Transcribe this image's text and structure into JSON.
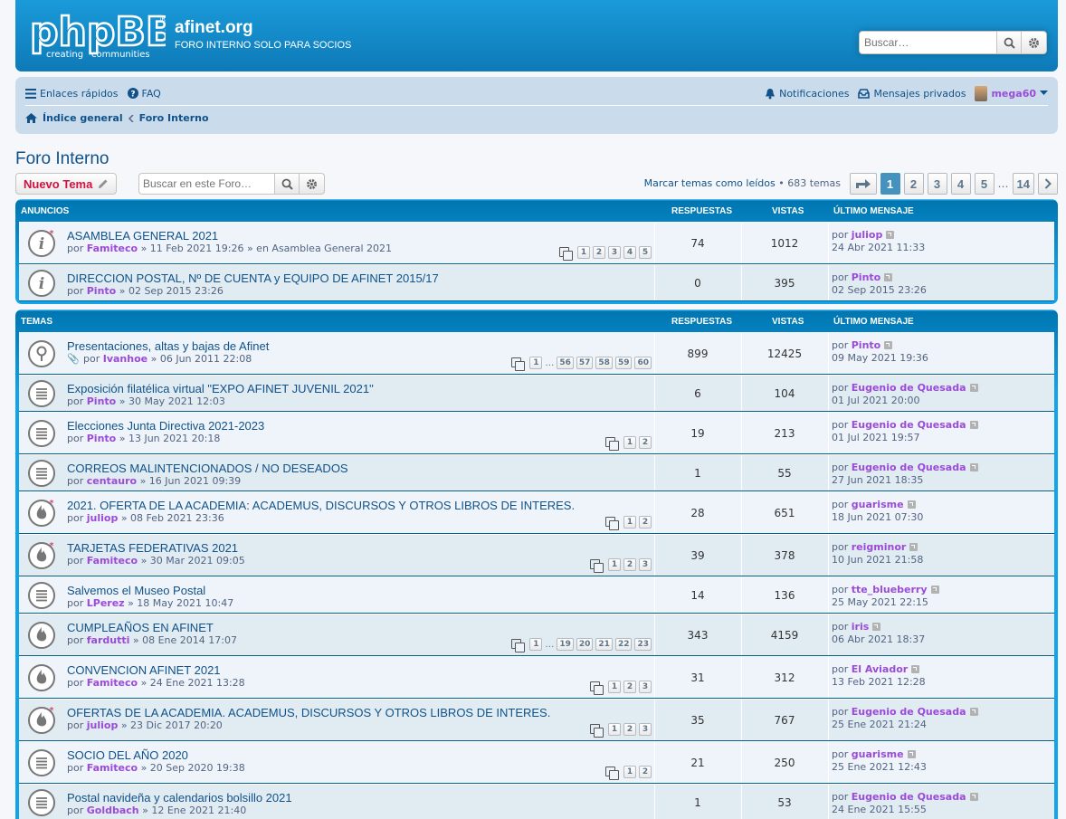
{
  "header": {
    "site_title": "afinet.org",
    "site_desc": "FORO INTERNO SOLO PARA SOCIOS",
    "logo_main": "phpBB",
    "logo_sub1": "creating",
    "logo_sub2": "communities",
    "search_placeholder": "Buscar…"
  },
  "navbar": {
    "quick_links": "Enlaces rápidos",
    "faq": "FAQ",
    "notifications": "Notificaciones",
    "pm": "Mensajes privados",
    "username": "mega60",
    "crumb_home": "Índice general",
    "crumb_forum": "Foro Interno"
  },
  "forum": {
    "title": "Foro Interno",
    "new_topic": "Nuevo Tema",
    "search_placeholder": "Buscar en este Foro…",
    "mark_read": "Marcar temas como leídos",
    "topic_count": "683 temas",
    "pages": [
      "1",
      "2",
      "3",
      "4",
      "5",
      "14"
    ],
    "bullet": "•",
    "dots": "…"
  },
  "columns": {
    "respuestas": "RESPUESTAS",
    "vistas": "VISTAS",
    "ultimo": "ÚLTIMO MENSAJE"
  },
  "announcements": {
    "header": "ANUNCIOS",
    "rows": [
      {
        "title": "ASAMBLEA GENERAL 2021",
        "por": "por",
        "author": "Famiteco",
        "date": "» 11 Feb 2021 19:26 » en Asamblea General 2021",
        "replies": "74",
        "views": "1012",
        "last_user": "juliop",
        "last_date": "24 Abr 2021 11:33",
        "pages": [
          "1",
          "2",
          "3",
          "4",
          "5"
        ]
      },
      {
        "title": "DIRECCION POSTAL, Nº DE CUENTA y EQUIPO DE AFINET 2015/17",
        "por": "por",
        "author": "Pinto",
        "date": "» 02 Sep 2015 23:26",
        "replies": "0",
        "views": "395",
        "last_user": "Pinto",
        "last_date": "02 Sep 2015 23:26",
        "pages": []
      }
    ]
  },
  "topics": {
    "header": "TEMAS",
    "rows": [
      {
        "title": "Presentaciones, altas y bajas de Afinet",
        "por": "por",
        "author": "Ivanhoe",
        "date": "» 06 Jun 2011 22:08",
        "replies": "899",
        "views": "12425",
        "last_user": "Pinto",
        "last_date": "09 May 2021 19:36",
        "pages": [
          "1",
          "…",
          "56",
          "57",
          "58",
          "59",
          "60"
        ]
      },
      {
        "title": "Exposición filatélica virtual \"EXPO AFINET JUVENIL 2021\"",
        "por": "por",
        "author": "Pinto",
        "date": "» 30 May 2021 12:03",
        "replies": "6",
        "views": "104",
        "last_user": "Eugenio de Quesada",
        "last_date": "01 Jul 2021 20:00",
        "pages": []
      },
      {
        "title": "Elecciones Junta Directiva 2021-2023",
        "por": "por",
        "author": "Pinto",
        "date": "» 13 Jun 2021 20:18",
        "replies": "19",
        "views": "213",
        "last_user": "Eugenio de Quesada",
        "last_date": "01 Jul 2021 19:57",
        "pages": [
          "1",
          "2"
        ]
      },
      {
        "title": "CORREOS MALINTENCIONADOS / NO DESEADOS",
        "por": "por",
        "author": "centauro",
        "date": "» 16 Jun 2021 09:39",
        "replies": "1",
        "views": "55",
        "last_user": "Eugenio de Quesada",
        "last_date": "27 Jun 2021 18:35",
        "pages": []
      },
      {
        "title": "2021. OFERTA DE LA ACADEMIA: ACADEMUS, DISCURSOS Y OTROS LIBROS DE INTERES.",
        "por": "por",
        "author": "juliop",
        "date": "» 08 Feb 2021 23:36",
        "replies": "28",
        "views": "651",
        "last_user": "guarisme",
        "last_date": "18 Jun 2021 07:30",
        "pages": [
          "1",
          "2"
        ]
      },
      {
        "title": "TARJETAS FEDERATIVAS 2021",
        "por": "por",
        "author": "Famiteco",
        "date": "» 30 Mar 2021 09:05",
        "replies": "39",
        "views": "378",
        "last_user": "reigminor",
        "last_date": "10 Jun 2021 21:58",
        "pages": [
          "1",
          "2",
          "3"
        ]
      },
      {
        "title": "Salvemos el Museo Postal",
        "por": "por",
        "author": "LPerez",
        "date": "» 18 May 2021 10:47",
        "replies": "14",
        "views": "136",
        "last_user": "tte_blueberry",
        "last_date": "25 May 2021 22:15",
        "pages": []
      },
      {
        "title": "CUMPLEAÑOS EN AFINET",
        "por": "por",
        "author": "fardutti",
        "date": "» 08 Ene 2014 17:07",
        "replies": "343",
        "views": "4159",
        "last_user": "iris",
        "last_date": "06 Abr 2021 18:37",
        "pages": [
          "1",
          "…",
          "19",
          "20",
          "21",
          "22",
          "23"
        ]
      },
      {
        "title": "CONVENCION AFINET 2021",
        "por": "por",
        "author": "Famiteco",
        "date": "» 24 Ene 2021 13:28",
        "replies": "31",
        "views": "312",
        "last_user": "El Aviador",
        "last_date": "13 Feb 2021 12:28",
        "pages": [
          "1",
          "2",
          "3"
        ]
      },
      {
        "title": "OFERTAS DE LA ACADEMIA. ACADEMUS, DISCURSOS Y OTROS LIBROS DE INTERES.",
        "por": "por",
        "author": "juliop",
        "date": "» 23 Dic 2017 20:20",
        "replies": "35",
        "views": "767",
        "last_user": "Eugenio de Quesada",
        "last_date": "25 Ene 2021 21:24",
        "pages": [
          "1",
          "2",
          "3"
        ]
      },
      {
        "title": "SOCIO DEL AÑO 2020",
        "por": "por",
        "author": "Famiteco",
        "date": "» 20 Sep 2020 19:38",
        "replies": "21",
        "views": "250",
        "last_user": "guarisme",
        "last_date": "25 Ene 2021 12:43",
        "pages": [
          "1",
          "2"
        ]
      },
      {
        "title": "Postal navideña y calendarios bolsillo 2021",
        "por": "por",
        "author": "Goldbach",
        "date": "» 12 Ene 2021 21:40",
        "replies": "1",
        "views": "53",
        "last_user": "Eugenio de Quesada",
        "last_date": "24 Ene 2021 15:55",
        "pages": []
      }
    ]
  }
}
